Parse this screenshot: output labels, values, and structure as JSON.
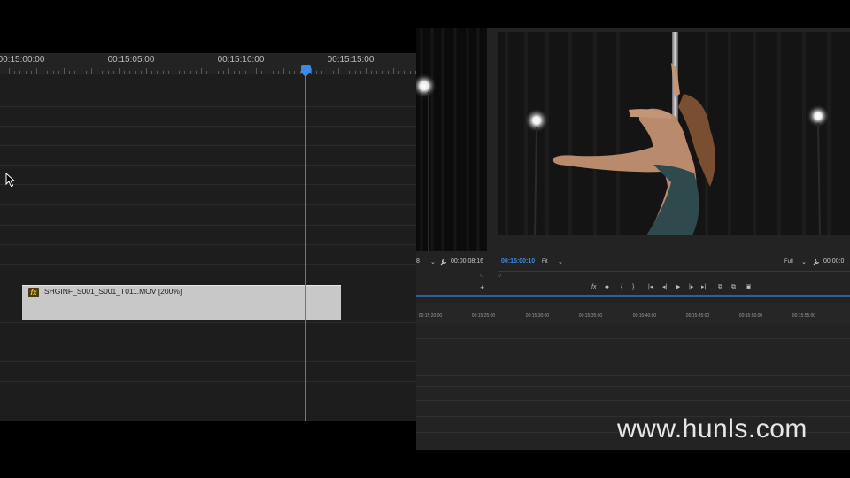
{
  "timeline": {
    "ruler_timecodes": [
      "00:15:00:00",
      "00:15:05:00",
      "00:15:10:00",
      "00:15:15:00"
    ],
    "clip": {
      "fx_label": "fx",
      "name": "SHGINF_S001_S001_T011.MOV [200%]"
    }
  },
  "premiere": {
    "source_monitor": {
      "timecode": "00:00:08:16",
      "tc_partial_left": "8",
      "chevron": "⌄"
    },
    "program_monitor": {
      "timecode": "00:15:00:10",
      "fit_label": "Fit",
      "quality_label": "Full",
      "end_timecode": "00:00:0"
    },
    "add_button": "+",
    "sequence_ruler_timecodes": [
      "00:15:20:00",
      "00:15:25:00",
      "00:15:30:00",
      "00:15:35:00",
      "00:15:40:00",
      "00:15:45:00",
      "00:15:50:00",
      "00:15:55:00"
    ]
  },
  "watermark": "www.hunls.com",
  "colors": {
    "playhead": "#3d8ae6",
    "clip": "#c8c8c8",
    "fx_badge": "#f2c12e"
  }
}
